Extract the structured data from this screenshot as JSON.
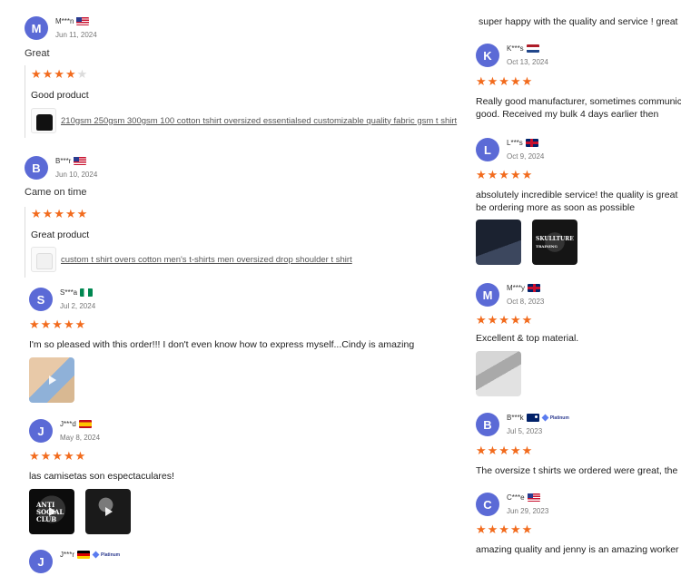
{
  "colors": {
    "avatar": "#5b6ad6",
    "star": "#f26b1d"
  },
  "left_reviews": [
    {
      "initial": "M",
      "name": "M***n",
      "flag": "us",
      "date": "Jun 11, 2024",
      "remark": "Great",
      "stars": "★★★★",
      "stars_off": "★",
      "rating": 4,
      "text": "Good product",
      "product": "210gsm 250gsm 300gsm 100 cotton tshirt oversized essentialsed customizable quality fabric gsm t shirt",
      "product_thumb_icon": "black-tshirt-thumbnail"
    },
    {
      "initial": "B",
      "name": "B***r",
      "flag": "us",
      "date": "Jun 10, 2024",
      "remark": "Came on time",
      "stars": "★★★★★",
      "rating": 5,
      "text": "Great product",
      "product": "custom t shirt overs cotton men's t-shirts men oversized drop shoulder t shirt",
      "product_thumb_icon": "white-tshirt-thumbnail"
    },
    {
      "initial": "S",
      "name": "S***a",
      "flag": "ng",
      "date": "Jul 2, 2024",
      "stars": "★★★★★",
      "rating": 5,
      "text": "I'm so pleased with this order!!! I don't even know how to express myself...Cindy is amazing"
    },
    {
      "initial": "J",
      "name": "J***d",
      "flag": "es",
      "date": "May 8, 2024",
      "stars": "★★★★★",
      "rating": 5,
      "text": "las camisetas son espectaculares!",
      "photo_text": [
        "ANTI",
        "SOCIAL",
        "CLUB"
      ]
    },
    {
      "initial": "J",
      "name": "J***r",
      "flag": "de",
      "badge": "Platinum"
    }
  ],
  "right_reviews": [
    {
      "text": "super happy with the quality and service ! great"
    },
    {
      "initial": "K",
      "name": "K***s",
      "flag": "nl",
      "date": "Oct 13, 2024",
      "stars": "★★★★★",
      "rating": 5,
      "text_lines": [
        "Really good manufacturer, sometimes communication",
        "good. Received my bulk 4 days earlier then"
      ]
    },
    {
      "initial": "L",
      "name": "L***s",
      "flag": "gb",
      "date": "Oct 9, 2024",
      "stars": "★★★★★",
      "rating": 5,
      "text_lines": [
        "absolutely incredible service! the quality is great",
        "be ordering more as soon as possible"
      ],
      "photo_text": [
        "SKULLTURE",
        "TRAINING"
      ]
    },
    {
      "initial": "M",
      "name": "M***y",
      "flag": "gb",
      "date": "Oct 8, 2023",
      "stars": "★★★★★",
      "rating": 5,
      "text_lines": [
        "Excellent & top material."
      ]
    },
    {
      "initial": "B",
      "name": "B***k",
      "flag": "au",
      "badge": "Platinum",
      "date": "Jul 5, 2023",
      "stars": "★★★★★",
      "rating": 5,
      "text_lines": [
        "The oversize t shirts we ordered were great, the"
      ]
    },
    {
      "initial": "C",
      "name": "C***e",
      "flag": "us",
      "date": "Jun 29, 2023",
      "stars": "★★★★★",
      "rating": 5,
      "text_lines": [
        "amazing quality and jenny is an amazing worker"
      ]
    }
  ]
}
